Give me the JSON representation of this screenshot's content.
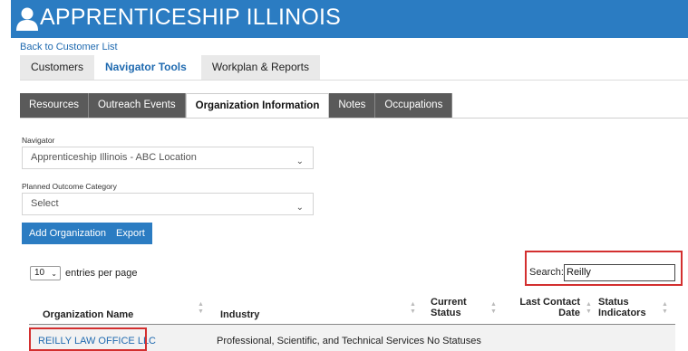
{
  "header": {
    "title": "APPRENTICESHIP ILLINOIS",
    "icon": "user-icon",
    "bg_color": "#2b7cc2"
  },
  "back_link": "Back to Customer List",
  "top_tabs": [
    {
      "label": "Customers",
      "active": false
    },
    {
      "label": "Navigator Tools",
      "active": true
    },
    {
      "label": "Workplan & Reports",
      "active": false
    }
  ],
  "sub_tabs": [
    {
      "label": "Resources",
      "active": false
    },
    {
      "label": "Outreach Events",
      "active": false
    },
    {
      "label": "Organization Information",
      "active": true
    },
    {
      "label": "Notes",
      "active": false
    },
    {
      "label": "Occupations",
      "active": false
    }
  ],
  "navigator": {
    "label": "Navigator",
    "value": "Apprenticeship Illinois - ABC Location"
  },
  "planned_outcome": {
    "label": "Planned Outcome Category",
    "value": "Select"
  },
  "buttons": {
    "add_org": "Add Organization",
    "export": "Export"
  },
  "entries": {
    "value": "10",
    "suffix": "entries per page"
  },
  "search": {
    "label": "Search:",
    "value": "Reilly"
  },
  "table": {
    "columns": [
      "Organization Name",
      "Industry",
      "Current Status",
      "Last Contact Date",
      "Status Indicators"
    ],
    "rows": [
      {
        "organization": "REILLY LAW OFFICE LLC",
        "industry": "Professional, Scientific, and Technical Services",
        "status": "No Statuses",
        "last_contact": "",
        "indicators": ""
      }
    ]
  },
  "colors": {
    "accent": "#2b7cc2",
    "highlight": "#d32f2f"
  }
}
